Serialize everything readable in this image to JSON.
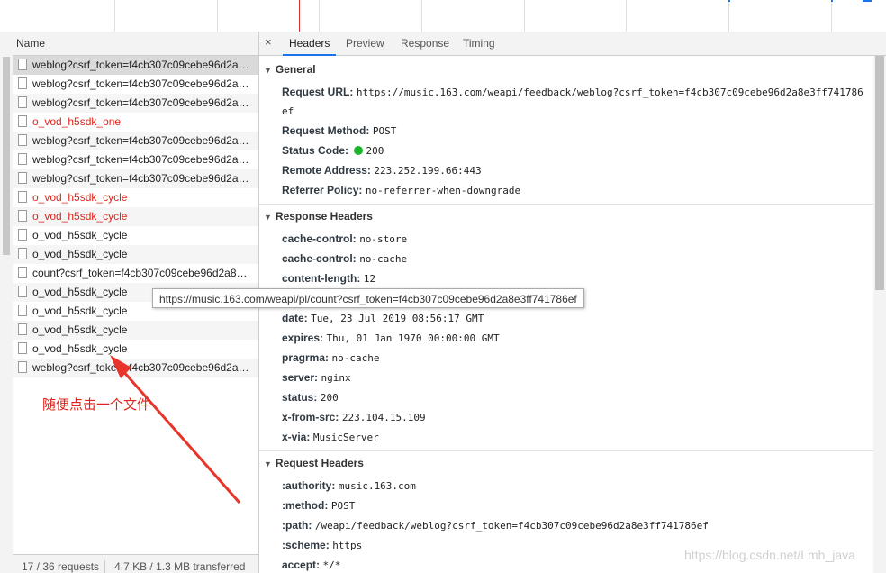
{
  "request_list": {
    "header": "Name",
    "rows": [
      {
        "name": "weblog?csrf_token=f4cb307c09cebe96d2a8...",
        "red": false
      },
      {
        "name": "weblog?csrf_token=f4cb307c09cebe96d2a8...",
        "red": false
      },
      {
        "name": "weblog?csrf_token=f4cb307c09cebe96d2a8...",
        "red": false
      },
      {
        "name": "o_vod_h5sdk_one",
        "red": true
      },
      {
        "name": "weblog?csrf_token=f4cb307c09cebe96d2a8...",
        "red": false
      },
      {
        "name": "weblog?csrf_token=f4cb307c09cebe96d2a8...",
        "red": false
      },
      {
        "name": "weblog?csrf_token=f4cb307c09cebe96d2a8...",
        "red": false
      },
      {
        "name": "o_vod_h5sdk_cycle",
        "red": true
      },
      {
        "name": "o_vod_h5sdk_cycle",
        "red": true
      },
      {
        "name": "o_vod_h5sdk_cycle",
        "red": false
      },
      {
        "name": "o_vod_h5sdk_cycle",
        "red": false
      },
      {
        "name": "count?csrf_token=f4cb307c09cebe96d2a8e3...",
        "red": false
      },
      {
        "name": "o_vod_h5sdk_cycle",
        "red": false
      },
      {
        "name": "o_vod_h5sdk_cycle",
        "red": false
      },
      {
        "name": "o_vod_h5sdk_cycle",
        "red": false
      },
      {
        "name": "o_vod_h5sdk_cycle",
        "red": false
      },
      {
        "name": "weblog?csrf_token=f4cb307c09cebe96d2a8...",
        "red": false
      }
    ],
    "status_requests": "17 / 36 requests",
    "status_transferred": "4.7 KB / 1.3 MB transferred"
  },
  "tabs": {
    "close": "×",
    "items": [
      "Headers",
      "Preview",
      "Response",
      "Timing"
    ]
  },
  "general": {
    "title": "General",
    "request_url_key": "Request URL:",
    "request_url_line1": "https://music.163.com/weapi/feedback/weblog?csrf_token=f4cb307c09cebe96d2a8e3ff741786",
    "request_url_line2": "ef",
    "method_key": "Request Method:",
    "method_val": "POST",
    "status_key": "Status Code:",
    "status_val": "200",
    "remote_key": "Remote Address:",
    "remote_val": "223.252.199.66:443",
    "referrer_key": "Referrer Policy:",
    "referrer_val": "no-referrer-when-downgrade"
  },
  "response_headers": {
    "title": "Response Headers",
    "items": [
      {
        "k": "cache-control:",
        "v": "no-store"
      },
      {
        "k": "cache-control:",
        "v": "no-cache"
      },
      {
        "k": "content-length:",
        "v": "12"
      },
      {
        "k": "",
        "v": ""
      },
      {
        "k": "date:",
        "v": "Tue, 23 Jul 2019 08:56:17 GMT"
      },
      {
        "k": "expires:",
        "v": "Thu, 01 Jan 1970 00:00:00 GMT"
      },
      {
        "k": "pragrma:",
        "v": "no-cache"
      },
      {
        "k": "server:",
        "v": "nginx"
      },
      {
        "k": "status:",
        "v": "200"
      },
      {
        "k": "x-from-src:",
        "v": "223.104.15.109"
      },
      {
        "k": "x-via:",
        "v": "MusicServer"
      }
    ]
  },
  "request_headers": {
    "title": "Request Headers",
    "items": [
      {
        "k": ":authority:",
        "v": "music.163.com"
      },
      {
        "k": ":method:",
        "v": "POST"
      },
      {
        "k": ":path:",
        "v": "/weapi/feedback/weblog?csrf_token=f4cb307c09cebe96d2a8e3ff741786ef"
      },
      {
        "k": ":scheme:",
        "v": "https"
      },
      {
        "k": "accept:",
        "v": "*/*"
      }
    ]
  },
  "tooltip": "https://music.163.com/weapi/pl/count?csrf_token=f4cb307c09cebe96d2a8e3ff741786ef",
  "annotation": "随便点击一个文件",
  "watermark": "https://blog.csdn.net/Lmh_java",
  "colors": {
    "accent": "#1a73e8",
    "red": "#e0241b",
    "green": "#1bb52c"
  }
}
